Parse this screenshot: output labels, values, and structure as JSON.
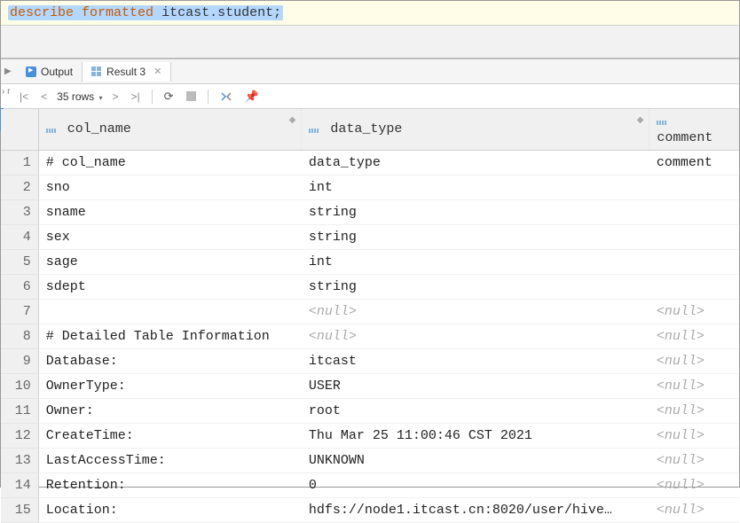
{
  "editor": {
    "keyword1": "describe",
    "keyword2": "formatted",
    "identifier": "itcast.student",
    "semicolon": ";"
  },
  "tabs": {
    "output": "Output",
    "result": "Result 3"
  },
  "toolbar": {
    "rows_label": "35 rows"
  },
  "columns": {
    "c1": "col_name",
    "c2": "data_type",
    "c3": "comment"
  },
  "rows": [
    {
      "n": "1",
      "c1": "# col_name",
      "c2": "data_type",
      "c3": "comment"
    },
    {
      "n": "2",
      "c1": "sno",
      "c2": "int",
      "c3": ""
    },
    {
      "n": "3",
      "c1": "sname",
      "c2": "string",
      "c3": ""
    },
    {
      "n": "4",
      "c1": "sex",
      "c2": "string",
      "c3": ""
    },
    {
      "n": "5",
      "c1": "sage",
      "c2": "int",
      "c3": ""
    },
    {
      "n": "6",
      "c1": "sdept",
      "c2": "string",
      "c3": ""
    },
    {
      "n": "7",
      "c1": "",
      "c2": "<null>",
      "c3": "<null>"
    },
    {
      "n": "8",
      "c1": "# Detailed Table Information",
      "c2": "<null>",
      "c3": "<null>"
    },
    {
      "n": "9",
      "c1": "Database:",
      "c2": "itcast",
      "c3": "<null>"
    },
    {
      "n": "10",
      "c1": "OwnerType:",
      "c2": "USER",
      "c3": "<null>"
    },
    {
      "n": "11",
      "c1": "Owner:",
      "c2": "root",
      "c3": "<null>"
    },
    {
      "n": "12",
      "c1": "CreateTime:",
      "c2": "Thu Mar 25 11:00:46 CST 2021",
      "c3": "<null>"
    },
    {
      "n": "13",
      "c1": "LastAccessTime:",
      "c2": "UNKNOWN",
      "c3": "<null>"
    },
    {
      "n": "14",
      "c1": "Retention:",
      "c2": "0",
      "c3": "<null>"
    },
    {
      "n": "15",
      "c1": "Location:",
      "c2": "hdfs://node1.itcast.cn:8020/user/hive…",
      "c3": "<null>"
    }
  ]
}
